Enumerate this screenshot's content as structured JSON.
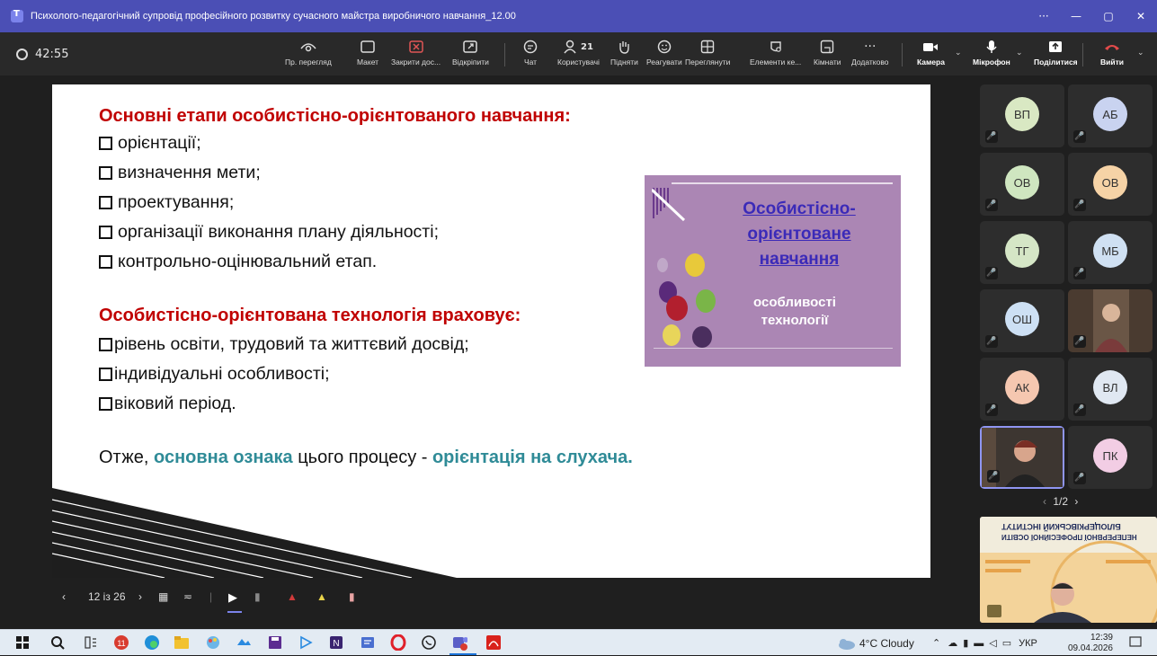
{
  "window": {
    "title": "Психолого-педагогічний супровід професійного розвитку сучасного майстра виробничого навчання_12.00",
    "controls": [
      "···",
      "—",
      "▢",
      "✕"
    ]
  },
  "toolbar": {
    "timer": "42:55",
    "buttons": {
      "preview": "Пр. перегляд",
      "layout": "Макет",
      "close_share": "Закрити дос...",
      "unpin": "Відкріпити",
      "chat": "Чат",
      "users": "Користувачі",
      "users_count": "21",
      "raise": "Підняти",
      "react": "Реагувати",
      "view": "Переглянути",
      "elements": "Елементи ке...",
      "rooms": "Кімнати",
      "more": "Додатково",
      "camera": "Камера",
      "mic": "Мікрофон",
      "share": "Поділитися",
      "leave": "Вийти"
    }
  },
  "slide": {
    "heading1": "Основні етапи особистісно-орієнтованого навчання:",
    "stages": [
      "орієнтації;",
      "визначення мети;",
      "проектування;",
      "організації виконання плану діяльності;",
      "контрольно-оцінювальний етап."
    ],
    "heading2": "Особистісно-орієнтована технологія враховує:",
    "factors": [
      "рівень освіти, трудовий та життєвий досвід;",
      "індивідуальні особливості;",
      "віковий період."
    ],
    "summary": {
      "pre": "Отже, ",
      "key1": "основна ознака",
      "mid": " цього процесу - ",
      "key2": "орієнтація на слухача."
    },
    "card": {
      "title_lines": [
        "Особистісно-",
        "орієнтоване",
        "навчання "
      ],
      "subtitle_lines": [
        "особливості",
        "технології"
      ]
    }
  },
  "slide_nav": {
    "counter": "12 із 26"
  },
  "participants": [
    {
      "initials": "ВП",
      "color": "#d9e8c3"
    },
    {
      "initials": "АБ",
      "color": "#c9d3f0"
    },
    {
      "initials": "ОВ",
      "color": "#cfe6c0"
    },
    {
      "initials": "ОВ",
      "color": "#f6d3a6"
    },
    {
      "initials": "ТГ",
      "color": "#d5e6c6"
    },
    {
      "initials": "МБ",
      "color": "#cfe0f2"
    },
    {
      "initials": "ОШ",
      "color": "#cde0f4"
    },
    {
      "initials": "АК",
      "color": "#f5c7b0"
    },
    {
      "initials": "ВЛ",
      "color": "#e0e8f2"
    },
    {
      "initials": "ПК",
      "color": "#f2cde4"
    }
  ],
  "pager": "1/2",
  "share_preview": {
    "line1": "БІЛОЦЕРКІВСЬКИЙ ІНСТИТУТ",
    "line2": "НЕПЕРЕРВНОЇ ПРОФЕСІЙНОЇ ОСВІТИ"
  },
  "taskbar": {
    "weather": "4°C  Cloudy",
    "lang": "УКР",
    "time": "12:39",
    "date": "09.04.2026"
  }
}
